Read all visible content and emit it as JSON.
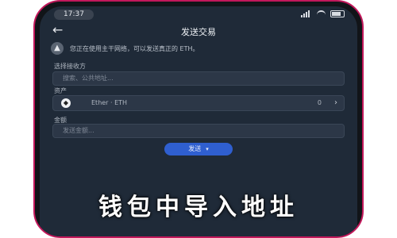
{
  "status": {
    "time": "17:37"
  },
  "nav": {
    "title": "发送交易"
  },
  "notice": {
    "text": "您正在使用主干网络，可以发送真正的 ETH。"
  },
  "recipient": {
    "label": "选择接收方",
    "placeholder": "搜索、公共地址..."
  },
  "asset": {
    "label": "资产",
    "name": "Ether · ETH",
    "balance": "0"
  },
  "amount": {
    "label": "金额",
    "placeholder": "发送金额..."
  },
  "send_button": {
    "label": "发送"
  },
  "banner": {
    "text": "钱包中导入地址"
  }
}
